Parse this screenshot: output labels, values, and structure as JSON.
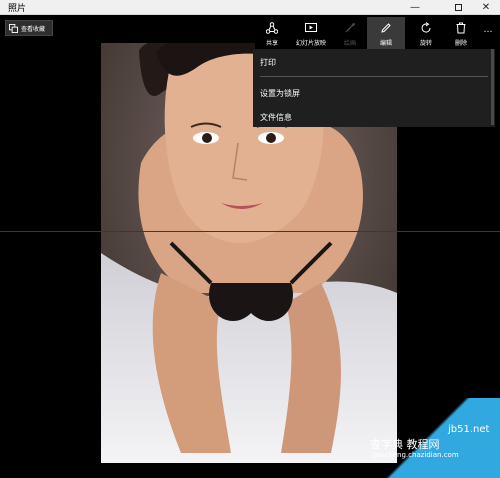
{
  "window": {
    "title": "照片",
    "minimize": "—",
    "close": "✕"
  },
  "back": {
    "label": "查看收藏"
  },
  "toolbar": {
    "items": [
      {
        "label": "共享",
        "icon": "share-icon"
      },
      {
        "label": "幻灯片放映",
        "icon": "slideshow-icon"
      },
      {
        "label": "绘画",
        "icon": "draw-icon",
        "disabled": true
      },
      {
        "label": "编辑",
        "icon": "edit-icon",
        "active": true
      },
      {
        "label": "旋转",
        "icon": "rotate-icon"
      },
      {
        "label": "删除",
        "icon": "delete-icon"
      },
      {
        "label": "…",
        "icon": "more-icon"
      }
    ]
  },
  "menu": {
    "items": [
      "打印",
      "设置为锁屏",
      "文件信息"
    ]
  },
  "watermark": {
    "line1": "jb51.net",
    "line2": "查字典 教程网",
    "line3": "jiaocheng.chazidian.com"
  }
}
